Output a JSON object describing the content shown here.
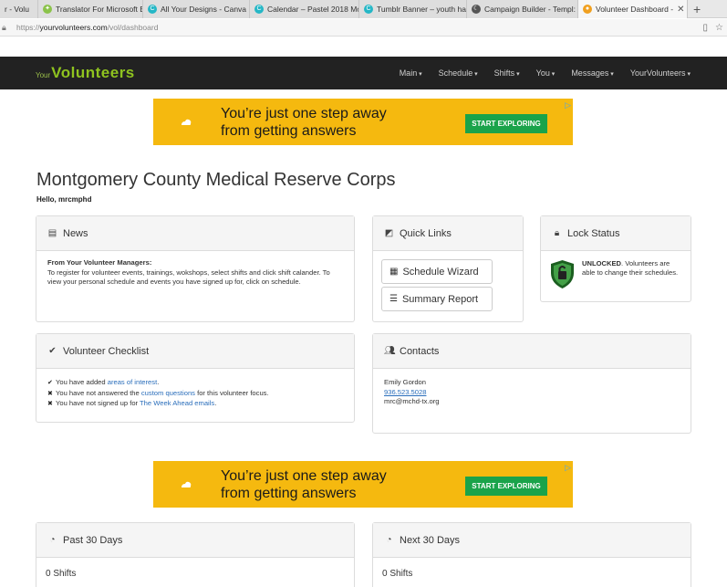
{
  "browser": {
    "tabs": [
      {
        "label": "r - Volu",
        "icon": "none"
      },
      {
        "label": "Translator For Microsoft Ec",
        "icon": "translator-icon"
      },
      {
        "label": "All Your Designs - Canva",
        "icon": "canva-icon"
      },
      {
        "label": "Calendar – Pastel 2018 Mo",
        "icon": "canva-icon"
      },
      {
        "label": "Tumblr Banner – youth has",
        "icon": "canva-icon"
      },
      {
        "label": "Campaign Builder - Templ:",
        "icon": "campaign-icon"
      },
      {
        "label": "Volunteer Dashboard -",
        "icon": "volunteer-icon"
      }
    ],
    "url_prefix": "https://",
    "url_host": "yourvolunteers.com",
    "url_path": "/vol/dashboard"
  },
  "navbar": {
    "logo_prefix": "Your",
    "logo_main": "Volunteers",
    "menu": [
      "Main",
      "Schedule",
      "Shifts",
      "You",
      "Messages",
      "YourVolunteers"
    ]
  },
  "ad": {
    "line1": "You’re just one step away",
    "line2": "from getting answers",
    "button": "START EXPLORING"
  },
  "page": {
    "org_title": "Montgomery County Medical Reserve Corps",
    "greeting": "Hello, mrcmphd"
  },
  "news": {
    "heading": "News",
    "subheading": "From Your Volunteer Managers:",
    "body": "To register for volunteer events, trainings, wokshops, select shifts and click shift calander. To view your personal schedule and events you have signed up for, click on schedule."
  },
  "quick_links": {
    "heading": "Quick Links",
    "schedule_wizard": "Schedule Wizard",
    "summary_report": "Summary Report"
  },
  "lock_status": {
    "heading": "Lock Status",
    "status": "UNLOCKED",
    "message": ". Volunteers are able to change their schedules."
  },
  "checklist": {
    "heading": "Volunteer Checklist",
    "items": [
      {
        "mark": "✔",
        "pre": "You have added ",
        "link": "areas of interest",
        "post": "."
      },
      {
        "mark": "✖",
        "pre": "You have not answered the ",
        "link": "custom questions",
        "post": " for this volunteer focus."
      },
      {
        "mark": "✖",
        "pre": "You have not signed up for ",
        "link": "The Week Ahead emails",
        "post": "."
      }
    ]
  },
  "contacts": {
    "heading": "Contacts",
    "name": "Emily Gordon",
    "phone": "936.523.5028",
    "email": "mrc@mchd-tx.org"
  },
  "past": {
    "heading": "Past 30 Days",
    "shifts": "0 Shifts"
  },
  "next": {
    "heading": "Next 30 Days",
    "shifts": "0 Shifts"
  },
  "colors": {
    "navbar": "#222222",
    "ad": "#f5b90f",
    "ad_button": "#1aa34a",
    "logo": "#8fc31f",
    "link": "#2a6ebb"
  }
}
